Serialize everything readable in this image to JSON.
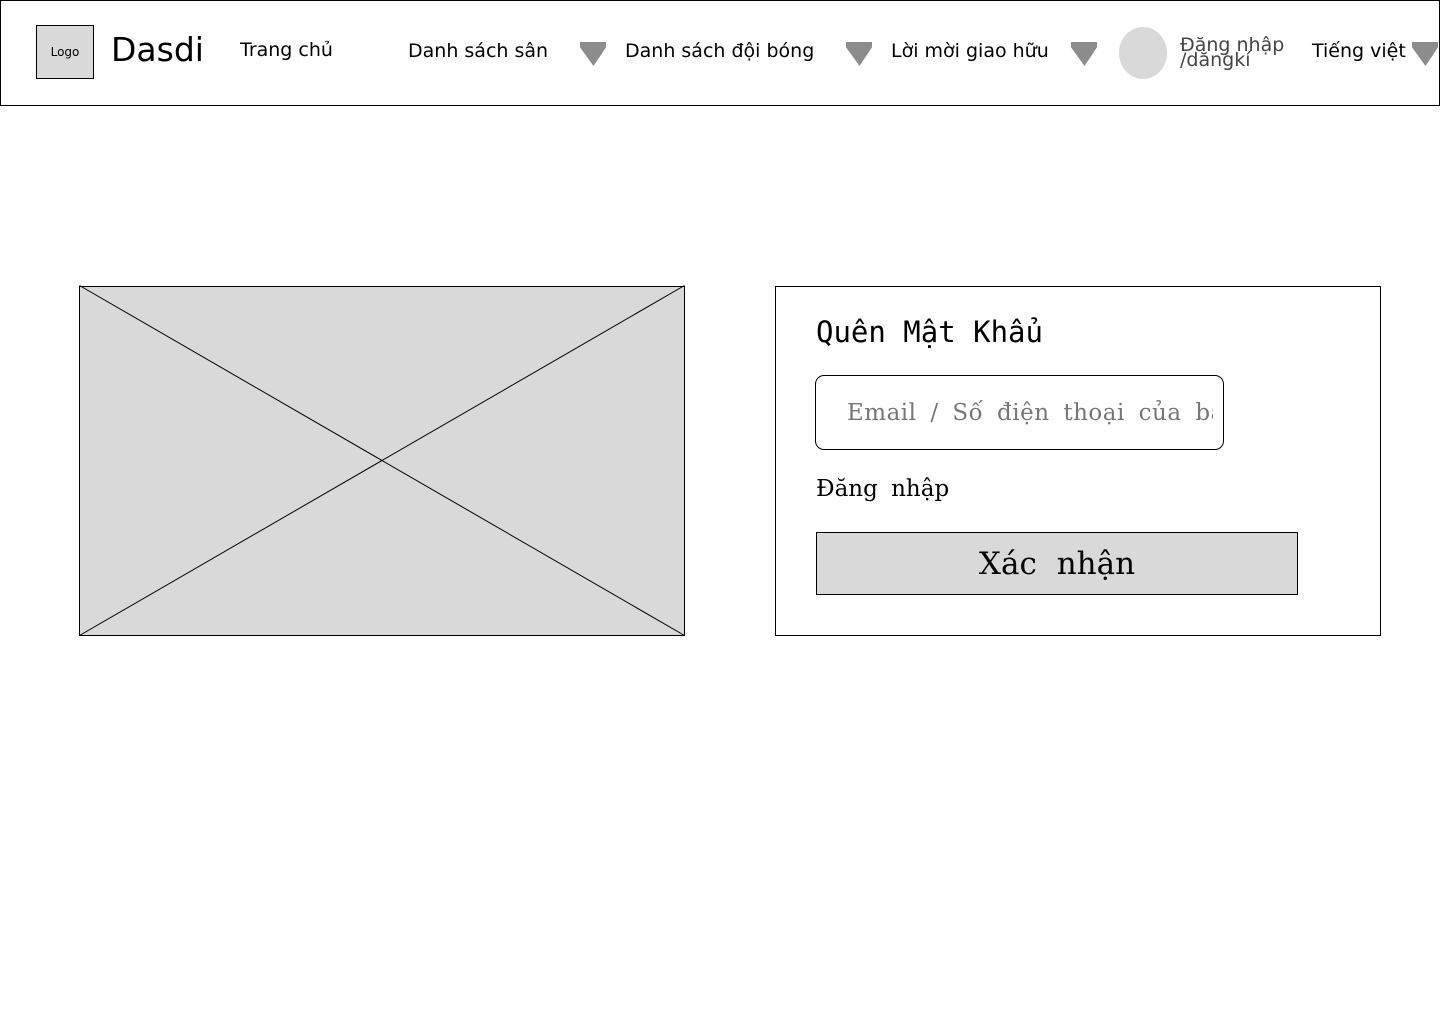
{
  "header": {
    "logo_text": "Logo",
    "brand": "Dasdi",
    "nav": {
      "home": "Trang chủ",
      "fields": "Danh sách sân",
      "teams": "Danh sách đội bóng",
      "invites": "Lời mời giao hữu"
    },
    "auth": {
      "line1": "Đăng nhập",
      "line2": "/dăngkí"
    },
    "language": "Tiếng việt",
    "icons": {
      "dropdown": "chevron-down-icon",
      "avatar": "avatar"
    }
  },
  "image_placeholder": {
    "icon": "image-placeholder-icon",
    "fill": "#d9d9d9"
  },
  "form": {
    "title": "Quên Mật Khẩu",
    "input": {
      "placeholder": "Email / Số điện thoại của bạn",
      "value": ""
    },
    "login_link": "Đăng nhập",
    "confirm_button": "Xác nhận"
  },
  "colors": {
    "placeholder_fill": "#d9d9d9",
    "caret": "#8c8c8c",
    "border": "#000000"
  }
}
